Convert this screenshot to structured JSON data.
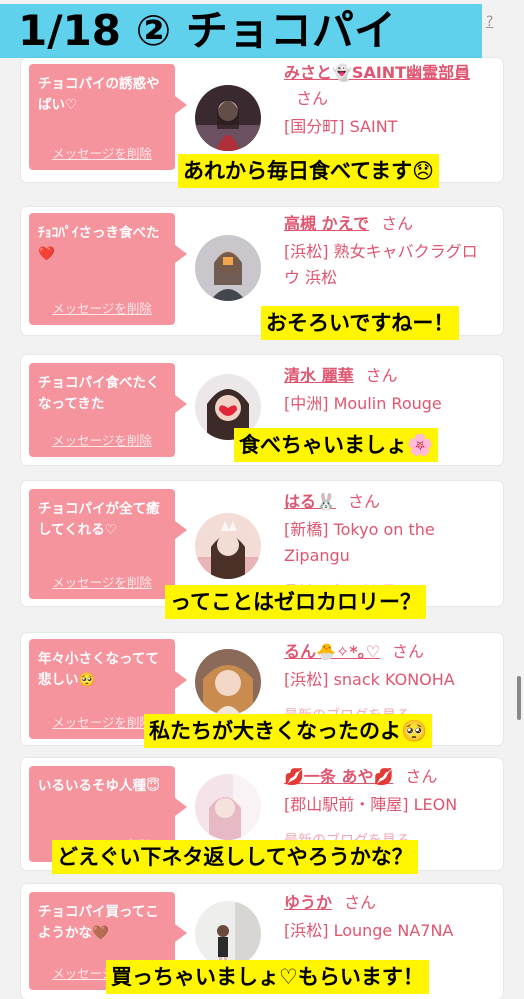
{
  "header": {
    "title": "1/18 ② チョコパイ",
    "help": "?"
  },
  "common": {
    "delete_label": "メッセージを削除",
    "honorific": "さん",
    "blog_link": "最新のブログを見る"
  },
  "cards": [
    {
      "message": "チョコパイの誘惑やばい♡",
      "name": "みさと👻SAINT幽霊部員",
      "store": "[国分町] SAINT",
      "caption": "あれから毎日食べてます😞"
    },
    {
      "message": "ﾁｮｺﾊﾟｲさっき食べた❤️",
      "name": "高槻 かえで",
      "store": "[浜松] 熟女キャバクラグロウ 浜松",
      "caption": "おそろいですねー！"
    },
    {
      "message": "チョコパイ食べたくなってきた",
      "name": "清水 麗華",
      "store": "[中洲] Moulin Rouge",
      "caption": "食べちゃいましょ🌸"
    },
    {
      "message": "チョコパイが全て癒してくれる♡",
      "name": "はる🐰",
      "store": "[新橋] Tokyo on the Zipangu",
      "caption": "ってことはゼロカロリー？"
    },
    {
      "message": "年々小さくなってて悲しい🥺",
      "name": "るん🐣✧*｡♡",
      "store": "[浜松] snack KONOHA",
      "caption": "私たちが大きくなったのよ🥺"
    },
    {
      "message": "いるいるそゆ人種😇",
      "name": "💋一条 あや💋",
      "store": "[郡山駅前・陣屋] LEON",
      "caption": "どえぐい下ネタ返ししてやろうかな？"
    },
    {
      "message": "チョコパイ買ってこようかな🤎",
      "name": "ゆうか",
      "store": "[浜松] Lounge NA7NA",
      "caption": "買っちゃいましょ♡もらいます！"
    }
  ]
}
